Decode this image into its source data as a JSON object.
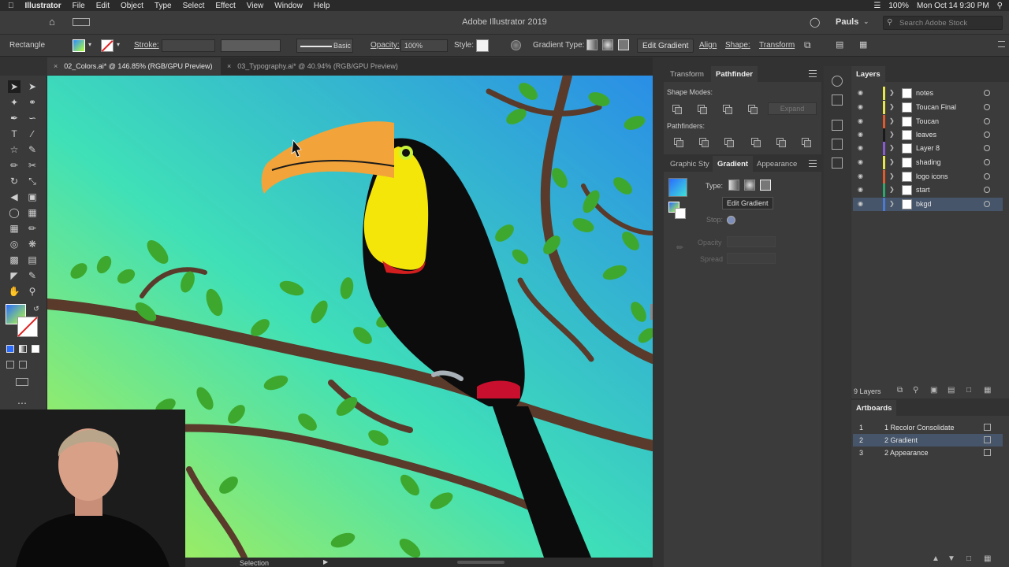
{
  "menubar": {
    "apple": "",
    "items": [
      "Illustrator",
      "File",
      "Edit",
      "Object",
      "Type",
      "Select",
      "Effect",
      "View",
      "Window",
      "Help"
    ],
    "clock": "Mon Oct 14  9:30 PM",
    "battery": "100%"
  },
  "titlebar": {
    "title": "Adobe Illustrator 2019",
    "user": "Pauls",
    "search_placeholder": "Search Adobe Stock"
  },
  "control": {
    "selection_type": "Rectangle",
    "stroke_label": "Stroke:",
    "brush_label": "Basic",
    "opacity_label": "Opacity:",
    "opacity_value": "100%",
    "style_label": "Style:",
    "gradient_type_label": "Gradient Type:",
    "edit_gradient": "Edit Gradient",
    "align": "Align",
    "shape": "Shape:",
    "transform": "Transform"
  },
  "tabs": [
    {
      "label": "02_Colors.ai* @ 146.85% (RGB/GPU Preview)",
      "active": true
    },
    {
      "label": "03_Typography.ai* @ 40.94% (RGB/GPU Preview)",
      "active": false
    }
  ],
  "status": {
    "tool": "Selection"
  },
  "pathfinder_panel": {
    "tabs": [
      "Transform",
      "Pathfinder"
    ],
    "shape_modes": "Shape Modes:",
    "expand": "Expand",
    "pathfinders": "Pathfinders:"
  },
  "gradient_panel": {
    "tabs": [
      "Graphic Sty",
      "Gradient",
      "Appearance"
    ],
    "type_label": "Type:",
    "edit_gradient": "Edit Gradient",
    "stop_label": "Stop:",
    "opacity_label": "Opacity",
    "spread_label": "Spread"
  },
  "layers_panel": {
    "title": "Layers",
    "layers": [
      {
        "name": "notes",
        "color": "#e6e64a"
      },
      {
        "name": "Toucan Final",
        "color": "#e6e64a"
      },
      {
        "name": "Toucan",
        "color": "#e05a2b"
      },
      {
        "name": "leaves",
        "color": "#1a1a1a"
      },
      {
        "name": "Layer 8",
        "color": "#8a5ad2"
      },
      {
        "name": "shading",
        "color": "#e6e64a"
      },
      {
        "name": "logo icons",
        "color": "#e05a2b"
      },
      {
        "name": "start",
        "color": "#2aa86e"
      },
      {
        "name": "bkgd",
        "color": "#4a7ad2",
        "selected": true
      }
    ],
    "count": "9 Layers"
  },
  "artboards_panel": {
    "title": "Artboards",
    "items": [
      {
        "num": "1",
        "name": "1 Recolor Consolidate"
      },
      {
        "num": "2",
        "name": "2 Gradient",
        "selected": true
      },
      {
        "num": "3",
        "name": "2 Appearance"
      }
    ]
  },
  "colors": {
    "accent_selection": "#46556a",
    "canvas_gradient_start": "#3fe6b8",
    "canvas_gradient_end": "#2aa0e6"
  }
}
